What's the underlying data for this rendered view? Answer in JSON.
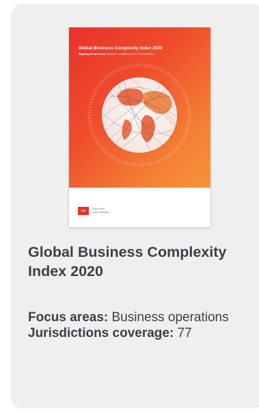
{
  "card": {
    "cover": {
      "title": "Global Business Complexity Index 2020",
      "subtitle_bold": "Mapping the landscape",
      "subtitle_rest": " corporate compliance risk in 77 jurisdictions",
      "logo_text": "TMF",
      "tagline_line1": "Global reach",
      "tagline_line2": "Local knowledge",
      "colors": {
        "gradient_start": "#e8322a",
        "gradient_end": "#f7933a"
      }
    },
    "title": "Global Business Complexity Index 2020",
    "focus_label": "Focus areas:",
    "focus_value": " Business operations",
    "jurisdictions_label": "Jurisdictions coverage:",
    "jurisdictions_value": " 77"
  }
}
